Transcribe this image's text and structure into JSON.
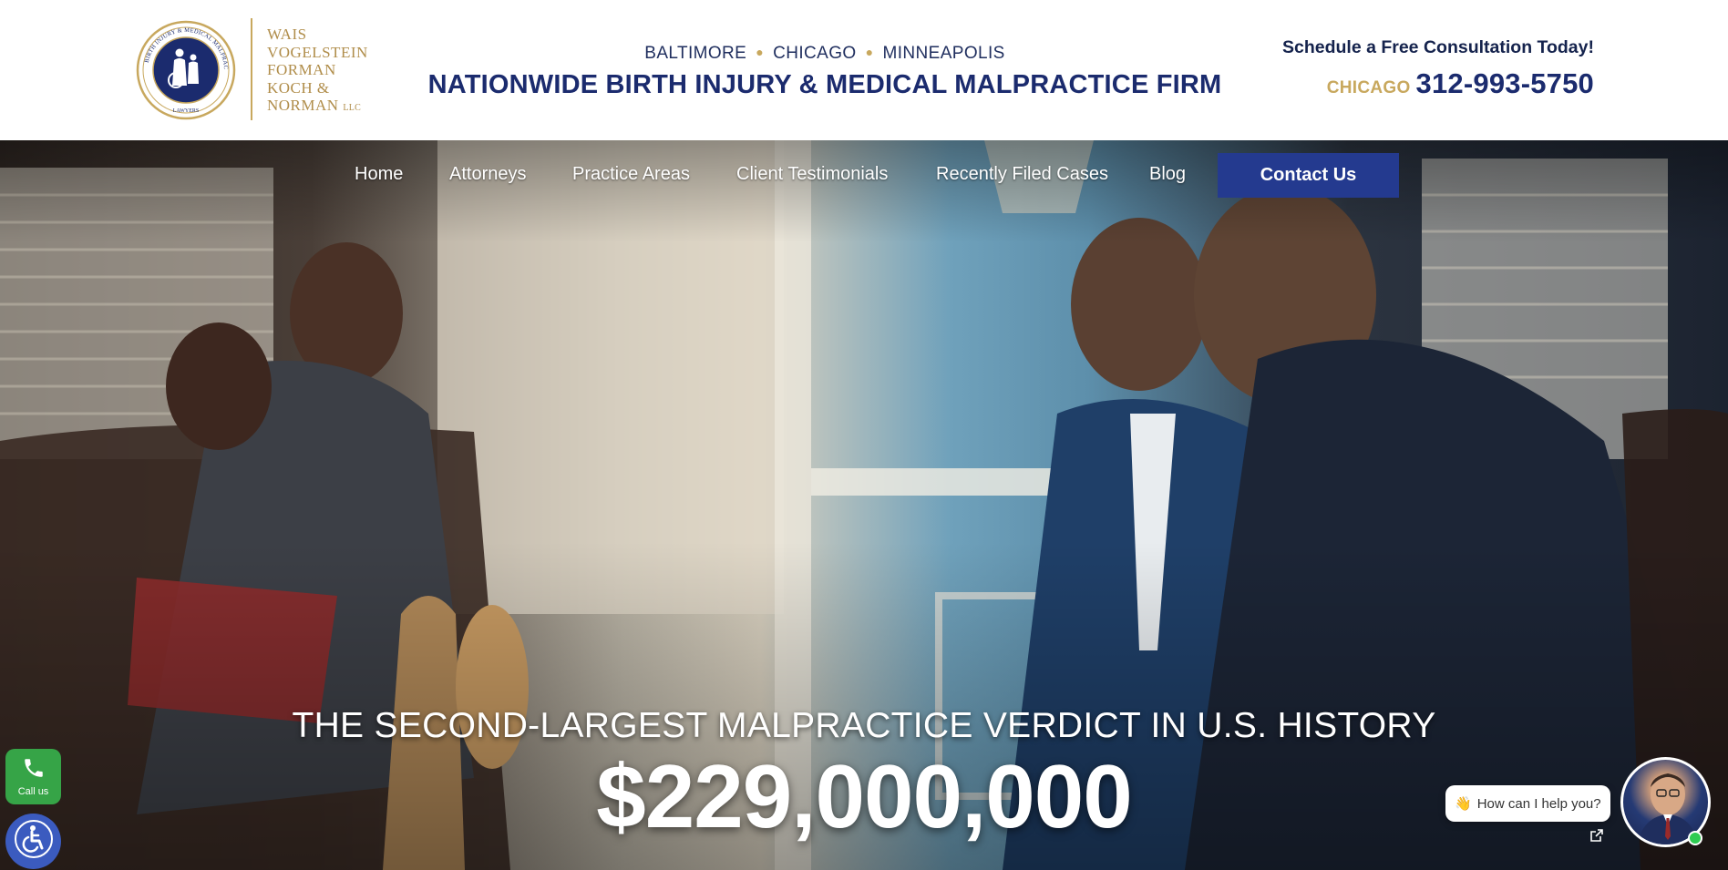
{
  "logo": {
    "seal_ring_text": "BIRTH INJURY & MEDICAL MALPRACTICE",
    "seal_bottom_text": "LAWYERS",
    "lines": [
      "WAIS",
      "VOGELSTEIN",
      "FORMAN",
      "KOCH &",
      "NORMAN"
    ],
    "llc": "LLC"
  },
  "header": {
    "cities": [
      "BALTIMORE",
      "CHICAGO",
      "MINNEAPOLIS"
    ],
    "firm_title": "NATIONWIDE BIRTH INJURY & MEDICAL MALPRACTICE FIRM",
    "schedule_text": "Schedule a Free Consultation Today!",
    "phone_city": "CHICAGO",
    "phone_number": "312-993-5750"
  },
  "nav": {
    "items": [
      "Home",
      "Attorneys",
      "Practice Areas",
      "Client Testimonials",
      "Recently Filed Cases",
      "Blog"
    ],
    "contact_label": "Contact Us"
  },
  "hero": {
    "verdict_line": "THE SECOND-LARGEST MALPRACTICE VERDICT IN U.S. HISTORY",
    "verdict_amount": "$229,000,000"
  },
  "widgets": {
    "call_label": "Call us",
    "chat_prompt": "How can I help you?",
    "call_icon": "phone-icon",
    "accessibility_icon": "wheelchair-icon"
  },
  "colors": {
    "navy": "#1b2b6e",
    "gold": "#c8a85e",
    "contact_button": "#243a8f",
    "call_green": "#36a447",
    "accessibility_blue": "#3b5bbf"
  }
}
